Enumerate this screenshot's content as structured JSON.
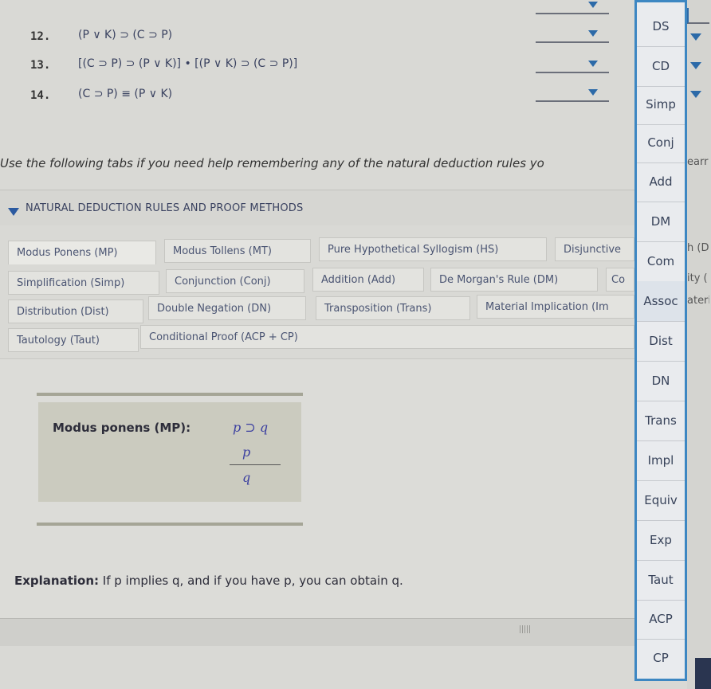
{
  "proof": {
    "lines": [
      {
        "num": "12.",
        "formula": "(P ∨ K) ⊃ (C ⊃ P)"
      },
      {
        "num": "13.",
        "formula": "[(C ⊃ P) ⊃ (P ∨ K)] • [(P ∨ K) ⊃ (C ⊃ P)]"
      },
      {
        "num": "14.",
        "formula": "(C ⊃ P) ≡ (P ∨ K)"
      }
    ]
  },
  "instructions": "Use the following tabs if you need help remembering any of the natural deduction rules yo",
  "section": {
    "title": "NATURAL DEDUCTION RULES AND PROOF METHODS"
  },
  "tabs": {
    "row1": [
      "Modus Ponens (MP)",
      "Modus Tollens (MT)",
      "Pure Hypothetical Syllogism (HS)",
      "Disjunctive"
    ],
    "row2": [
      "Simplification (Simp)",
      "Conjunction (Conj)",
      "Addition (Add)",
      "De Morgan's Rule (DM)",
      "Co"
    ],
    "row3": [
      "Distribution (Dist)",
      "Double Negation (DN)",
      "Transposition (Trans)",
      "Material Implication (Im"
    ],
    "row4": [
      "Tautology (Taut)",
      "Conditional Proof (ACP + CP)"
    ]
  },
  "rule": {
    "label": "Modus ponens (MP):",
    "premise1": "p ⊃ q",
    "premise2": "p",
    "conclusion": "q"
  },
  "explanation": {
    "label": "Explanation:",
    "text": " If p implies q, and if you have p, you can obtain q."
  },
  "dropdown": {
    "options": [
      "DS",
      "CD",
      "Simp",
      "Conj",
      "Add",
      "DM",
      "Com",
      "Assoc",
      "Dist",
      "DN",
      "Trans",
      "Impl",
      "Equiv",
      "Exp",
      "Taut",
      "ACP",
      "CP"
    ]
  },
  "right_fragments": {
    "instr": "earr",
    "row1": "h (D",
    "row2": "ity (",
    "row3": "ateri"
  }
}
